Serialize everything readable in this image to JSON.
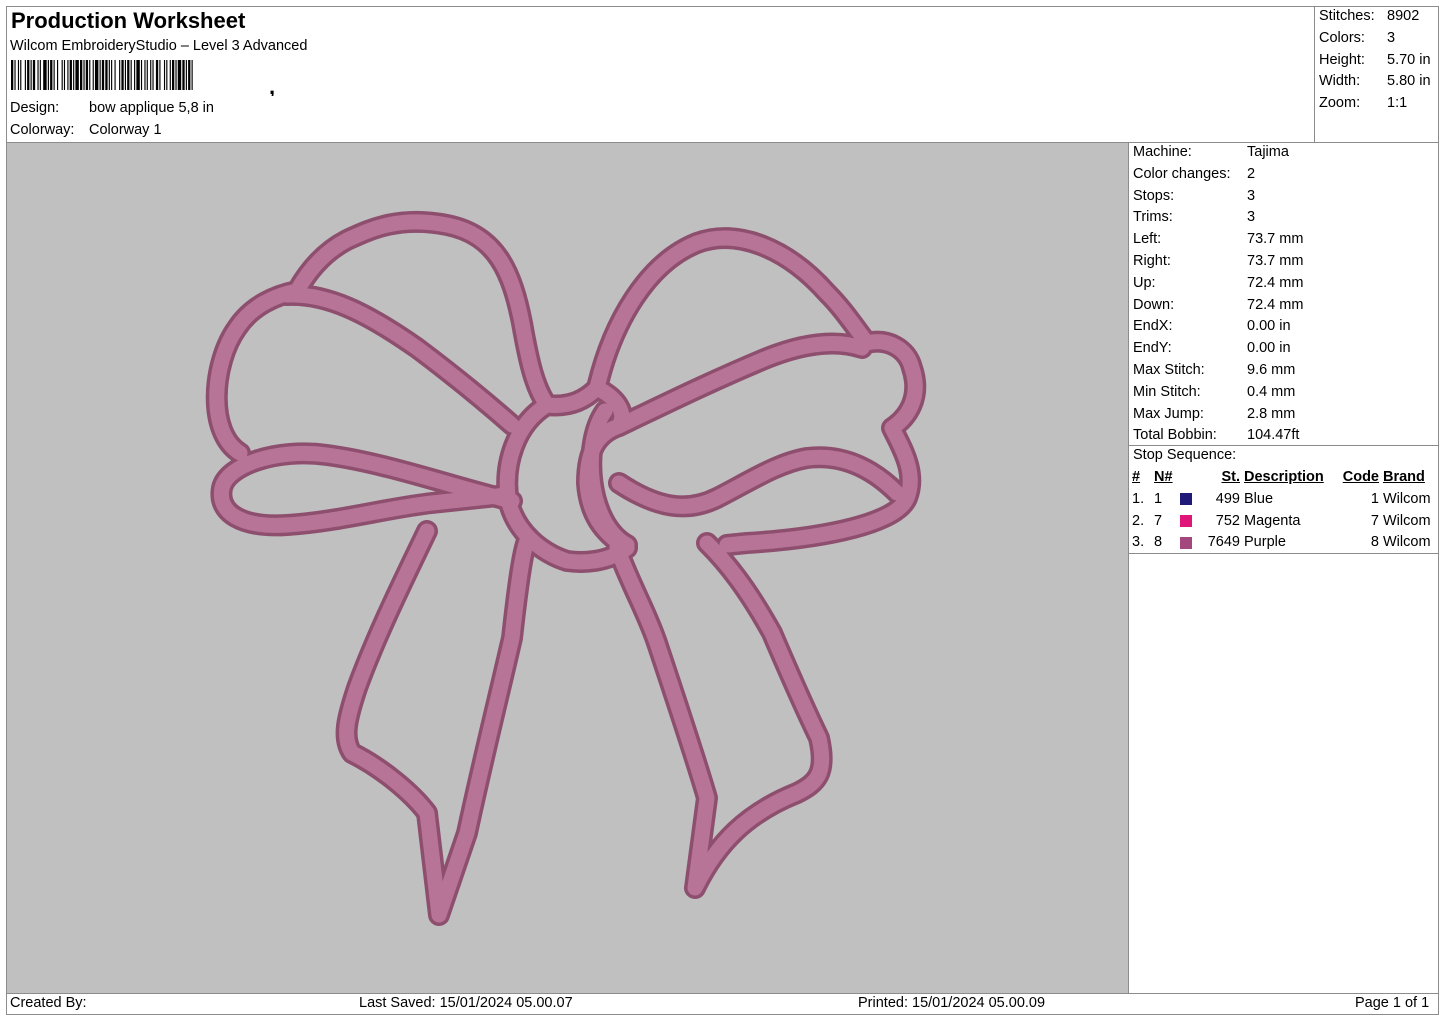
{
  "header": {
    "title": "Production Worksheet",
    "subtitle": "Wilcom EmbroideryStudio – Level 3 Advanced",
    "design_label": "Design:",
    "design_value": "bow applique 5,8 in",
    "colorway_label": "Colorway:",
    "colorway_value": "Colorway 1"
  },
  "summary": {
    "stitches_label": "Stitches:",
    "stitches": "8902",
    "colors_label": "Colors:",
    "colors": "3",
    "height_label": "Height:",
    "height": "5.70 in",
    "width_label": "Width:",
    "width": "5.80 in",
    "zoom_label": "Zoom:",
    "zoom": "1:1"
  },
  "machine": {
    "rows": [
      {
        "label": "Machine:",
        "value": "Tajima"
      },
      {
        "label": "Color changes:",
        "value": "2"
      },
      {
        "label": "Stops:",
        "value": "3"
      },
      {
        "label": "Trims:",
        "value": "3"
      },
      {
        "label": "Left:",
        "value": "73.7 mm"
      },
      {
        "label": "Right:",
        "value": "73.7 mm"
      },
      {
        "label": "Up:",
        "value": "72.4 mm"
      },
      {
        "label": "Down:",
        "value": "72.4 mm"
      },
      {
        "label": "EndX:",
        "value": "0.00 in"
      },
      {
        "label": "EndY:",
        "value": "0.00 in"
      },
      {
        "label": "Max Stitch:",
        "value": "9.6 mm"
      },
      {
        "label": "Min Stitch:",
        "value": "0.4 mm"
      },
      {
        "label": "Max Jump:",
        "value": "2.8 mm"
      },
      {
        "label": "Total Bobbin:",
        "value": "104.47ft"
      }
    ]
  },
  "stop_sequence": {
    "title": "Stop Sequence:",
    "headers": {
      "num": "#",
      "n": "N#",
      "st": "St.",
      "desc": "Description",
      "code": "Code",
      "brand": "Brand"
    },
    "rows": [
      {
        "num": "1.",
        "n": "1",
        "color": "#1f1a78",
        "st": "499",
        "desc": "Blue",
        "code": "1",
        "brand": "Wilcom"
      },
      {
        "num": "2.",
        "n": "7",
        "color": "#e0157a",
        "st": "752",
        "desc": "Magenta",
        "code": "7",
        "brand": "Wilcom"
      },
      {
        "num": "3.",
        "n": "8",
        "color": "#a3477e",
        "st": "7649",
        "desc": "Purple",
        "code": "8",
        "brand": "Wilcom"
      }
    ]
  },
  "design_preview": {
    "background": "#c0c0c0",
    "thread_color": "#b87497",
    "thread_shade": "#8e4f6f"
  },
  "footer": {
    "created_by": "Created By:",
    "last_saved": "Last Saved: 15/01/2024 05.00.07",
    "printed": "Printed: 15/01/2024 05.00.09",
    "page": "Page 1 of 1"
  }
}
